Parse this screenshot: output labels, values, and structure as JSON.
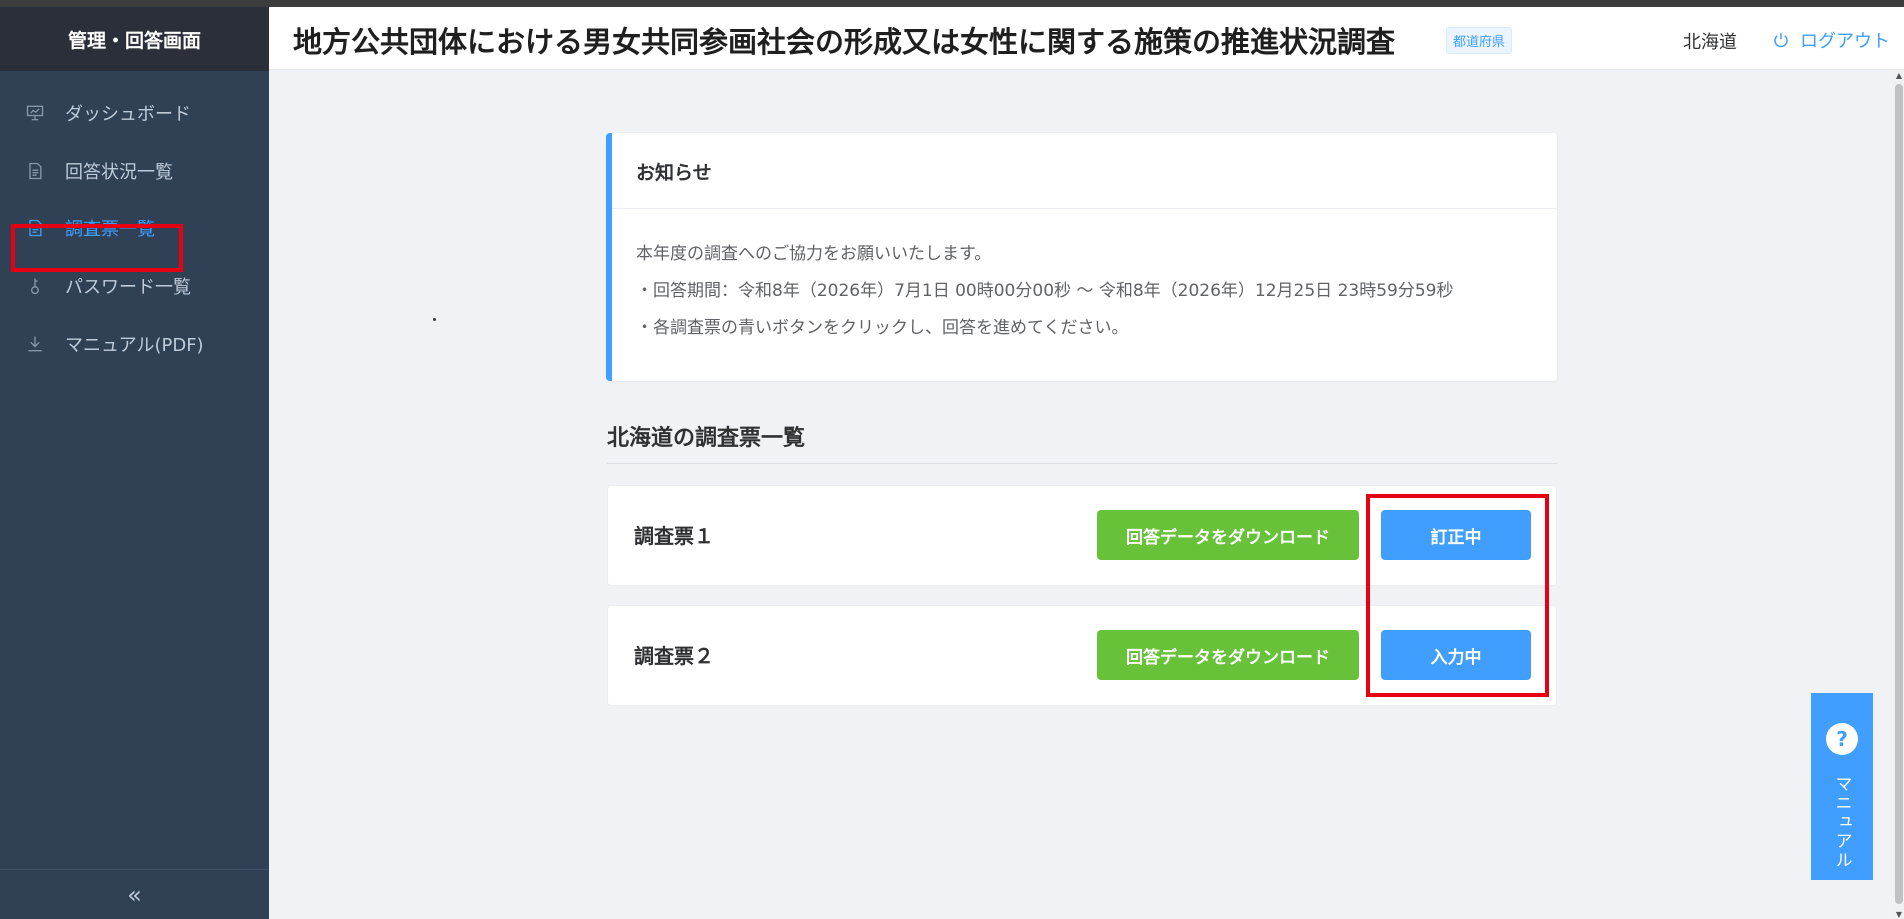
{
  "sidebar": {
    "title": "管理・回答画面",
    "items": [
      {
        "label": "ダッシュボード",
        "icon": "presentation-icon"
      },
      {
        "label": "回答状況一覧",
        "icon": "document-icon"
      },
      {
        "label": "調査票一覧",
        "icon": "document-icon",
        "active": true
      },
      {
        "label": "パスワード一覧",
        "icon": "key-icon"
      },
      {
        "label": "マニュアル(PDF)",
        "icon": "download-icon"
      }
    ],
    "collapse_icon": "«"
  },
  "header": {
    "title": "地方公共団体における男女共同参画社会の形成又は女性に関する施策の推進状況調査",
    "badge": "都道府県",
    "prefecture": "北海道",
    "logout_label": "ログアウト"
  },
  "notice": {
    "title": "お知らせ",
    "lines": [
      "本年度の調査へのご協力をお願いいたします。",
      "・回答期間：令和8年（2026年）7月1日 00時00分00秒 〜 令和8年（2026年）12月25日 23時59分59秒",
      "・各調査票の青いボタンをクリックし、回答を進めてください。"
    ]
  },
  "surveys": {
    "heading": "北海道の調査票一覧",
    "items": [
      {
        "name": "調査票１",
        "download_label": "回答データをダウンロード",
        "status_label": "訂正中"
      },
      {
        "name": "調査票２",
        "download_label": "回答データをダウンロード",
        "status_label": "入力中"
      }
    ]
  },
  "floating_manual": {
    "icon": "?",
    "label": "マニュアル"
  },
  "colors": {
    "sidebar_bg": "#304156",
    "accent": "#409eff",
    "download_green": "#67c23a",
    "highlight_red": "#e60012"
  }
}
